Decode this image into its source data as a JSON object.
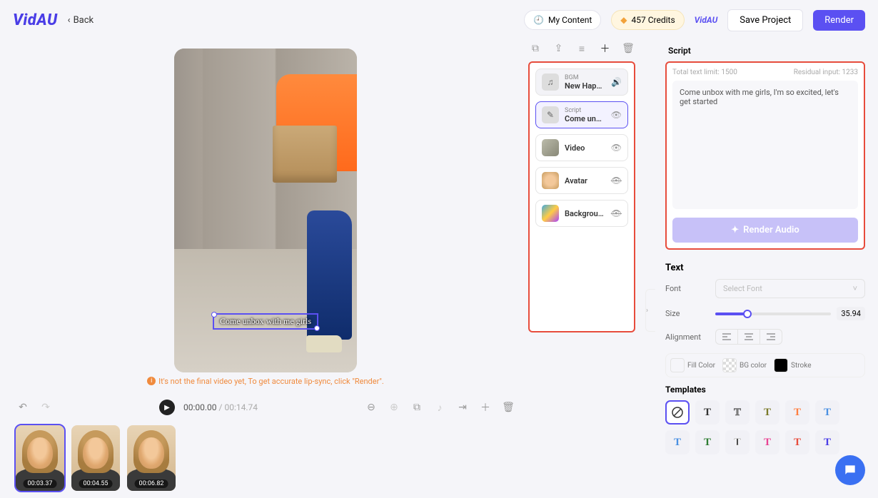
{
  "topbar": {
    "logo": "VidAU",
    "back": "Back",
    "my_content": "My Content",
    "credits": "457 Credits",
    "brand_sm": "VidAU",
    "save": "Save Project",
    "render": "Render"
  },
  "preview": {
    "caption": "Come unbox with me girls",
    "hint": "It's not the final video yet, To get accurate lip-sync, click \"Render\"."
  },
  "transport": {
    "current": "00:00.00",
    "duration": "00:14.74"
  },
  "clips": [
    {
      "ts": "00:03.37"
    },
    {
      "ts": "00:04.55"
    },
    {
      "ts": "00:06.82"
    }
  ],
  "layers": {
    "bgm_label": "BGM",
    "bgm_title": "New Happiness",
    "script_label": "Script",
    "script_title": "Come unbox ...",
    "video_title": "Video",
    "avatar_title": "Avatar",
    "background_title": "Background"
  },
  "script": {
    "heading": "Script",
    "limit_label": "Total text limit: 1500",
    "residual_label": "Residual input: 1233",
    "content": "Come unbox with me girls, I'm so excited, let's get started",
    "render_audio": "Render Audio"
  },
  "text_panel": {
    "heading": "Text",
    "font_label": "Font",
    "font_placeholder": "Select Font",
    "size_label": "Size",
    "size_value": "35.94",
    "alignment_label": "Alignment",
    "fill_label": "Fill Color",
    "bg_label": "BG color",
    "stroke_label": "Stroke",
    "templates_label": "Templates"
  },
  "template_colors": [
    "#333333",
    "#808080",
    "#7a7a2a",
    "#ff7f41",
    "#4a90e2",
    "#4a90e2",
    "#2e7d32",
    "#333333",
    "#e84393",
    "#e74c3c",
    "#4a3de6"
  ]
}
